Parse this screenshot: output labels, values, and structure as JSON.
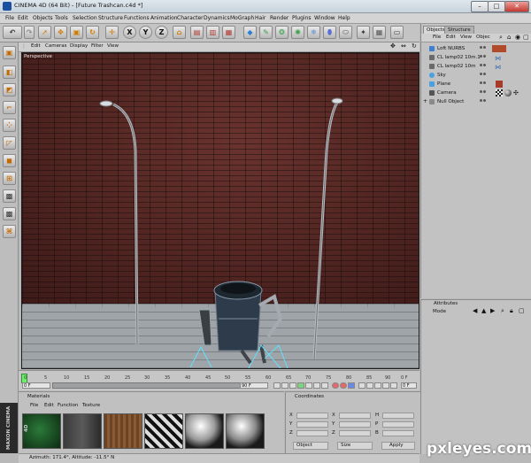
{
  "window": {
    "title": "CINEMA 4D (64 Bit) - [Future Trashcan.c4d *]"
  },
  "menubar": [
    "File",
    "Edit",
    "Objects",
    "Tools",
    "Selection",
    "Structure",
    "Functions",
    "Animation",
    "Character",
    "Dynamics",
    "MoGraph",
    "Hair",
    "Render",
    "Plugins",
    "Window",
    "Help"
  ],
  "toolbar": {
    "axis_x": "X",
    "axis_y": "Y",
    "axis_z": "Z"
  },
  "viewport": {
    "menu": [
      "Edit",
      "Cameras",
      "Display",
      "Filter",
      "View"
    ],
    "label": "Perspective"
  },
  "objects_panel": {
    "tabs": [
      "Objects",
      "Structure"
    ],
    "menu": [
      "File",
      "Edit",
      "View",
      "Objec"
    ],
    "items": [
      {
        "name": "Loft NURBS",
        "icon_color": "#3f7fd1"
      },
      {
        "name": "CL lamp02 10m.1",
        "icon_color": "#6a6a6a"
      },
      {
        "name": "CL lamp02 10m",
        "icon_color": "#6a6a6a"
      },
      {
        "name": "Sky",
        "icon_color": "#4aa0e0"
      },
      {
        "name": "Plane",
        "icon_color": "#4aa0e0"
      },
      {
        "name": "Camera",
        "icon_color": "#555555"
      },
      {
        "name": "Null Object",
        "icon_color": "#8a8a8a"
      }
    ]
  },
  "attributes_panel": {
    "title": "Attributes",
    "mode": "Mode"
  },
  "timeline": {
    "ticks": [
      "0",
      "5",
      "10",
      "15",
      "20",
      "25",
      "30",
      "35",
      "40",
      "45",
      "50",
      "55",
      "60",
      "65",
      "70",
      "75",
      "80",
      "85",
      "90"
    ],
    "start": "0 F",
    "end": "90 F",
    "current": "0 F",
    "end_field": "0 F"
  },
  "materials_panel": {
    "title": "Materials",
    "menu": [
      "File",
      "Edit",
      "Function",
      "Texture"
    ]
  },
  "coordinates_panel": {
    "title": "Coordinates",
    "rows": [
      {
        "a": "X",
        "b": "X",
        "c": "H"
      },
      {
        "a": "Y",
        "b": "Y",
        "c": "P"
      },
      {
        "a": "Z",
        "b": "Z",
        "c": "B"
      }
    ],
    "object_btn": "Object",
    "size_btn": "Size",
    "apply_btn": "Apply"
  },
  "statusbar": {
    "text": "Azimuth: 171.4°, Altitude: -11.5°  N"
  },
  "logo": {
    "text": "MAXON CINEMA 4D"
  },
  "watermark": {
    "text": "pxleyes.com"
  }
}
